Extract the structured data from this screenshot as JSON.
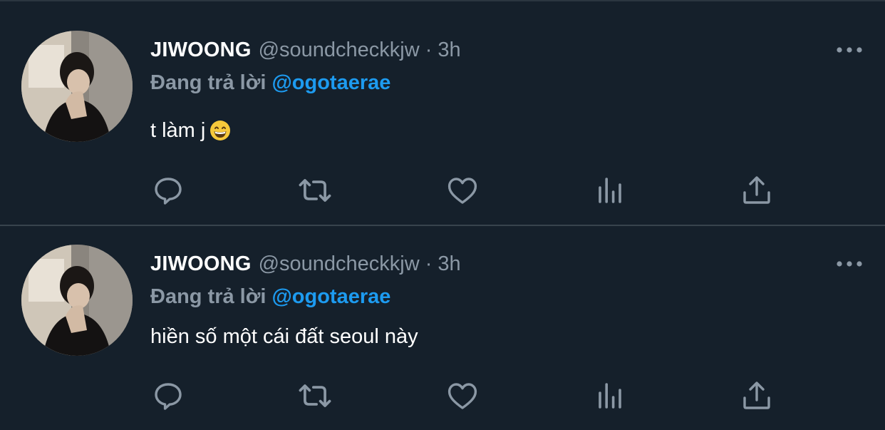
{
  "colors": {
    "background": "#15202b",
    "divider": "#38444d",
    "text": "#ffffff",
    "secondary": "#8b98a5",
    "accent": "#1d9bf0",
    "icon": "#8b98a5"
  },
  "tweets": [
    {
      "display_name": "JIWOONG",
      "handle": "@soundcheckkjw",
      "separator": "·",
      "time": "3h",
      "reply_prefix": "Đang trả lời",
      "reply_to": "@ogotaerae",
      "text": "t làm j",
      "emoji": "grinning-face-emoji",
      "more_icon": "more-icon",
      "actions": [
        "reply-icon",
        "retweet-icon",
        "like-icon",
        "analytics-icon",
        "share-icon"
      ]
    },
    {
      "display_name": "JIWOONG",
      "handle": "@soundcheckkjw",
      "separator": "·",
      "time": "3h",
      "reply_prefix": "Đang trả lời",
      "reply_to": "@ogotaerae",
      "text": "hiền số một cái đất seoul này",
      "more_icon": "more-icon",
      "actions": [
        "reply-icon",
        "retweet-icon",
        "like-icon",
        "analytics-icon",
        "share-icon"
      ]
    }
  ]
}
